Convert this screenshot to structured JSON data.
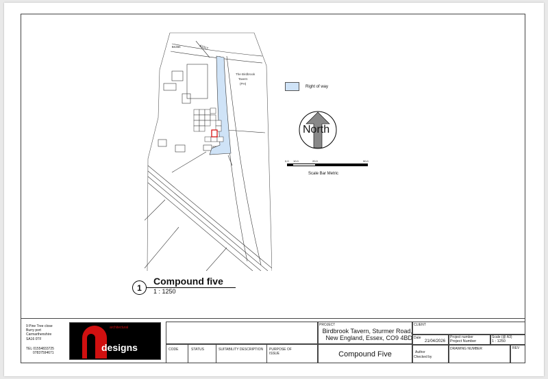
{
  "map_labels": {
    "bm": "84.8m",
    "road_no": "A1017",
    "pub_line1": "The Birdbrook",
    "pub_line2": "Tavern",
    "pub_line3": "(PH)"
  },
  "legend": {
    "label": "Right of way",
    "swatch_color": "#cfe3f7"
  },
  "north_arrow": {
    "label": "North"
  },
  "scale_bar": {
    "ticks": [
      "0.0",
      "10.0",
      "20.0",
      "90.0"
    ],
    "title": "Scale Bar Metric"
  },
  "view": {
    "number": "1",
    "title": "Compound five",
    "scale": "1 : 1250"
  },
  "title_block": {
    "address_lines": [
      "9 Pine Tree close",
      "Burry port",
      "Carmarthenshire",
      "SA16 0TF",
      "",
      "TEL 01554833725",
      "07837594671"
    ],
    "logo_text": "designs",
    "logo_letter": "A",
    "logo_small": "architectural",
    "columns": [
      "CODE",
      "STATUS",
      "SUITABILITY DESCRIPTION",
      "PURPOSE OF ISSUE"
    ],
    "project_label": "PROJECT",
    "project_lines": [
      "Birdbrook Tavern, Sturmer Road,",
      "New England, Essex, CO9 4BD"
    ],
    "client_label": "CLIENT",
    "date_label": "Date",
    "date_value": "21/04/2026",
    "project_number_label": "Project number",
    "project_number_value": "Project Number",
    "scale_label": "Scale (@ A3)",
    "scale_value": "1 : 1250",
    "drawing_title": "Compound Five",
    "author_label": "Author",
    "checked_label": "Checked by",
    "drawing_number_label": "DRAWING NUMBER",
    "rev_label": "REV"
  }
}
